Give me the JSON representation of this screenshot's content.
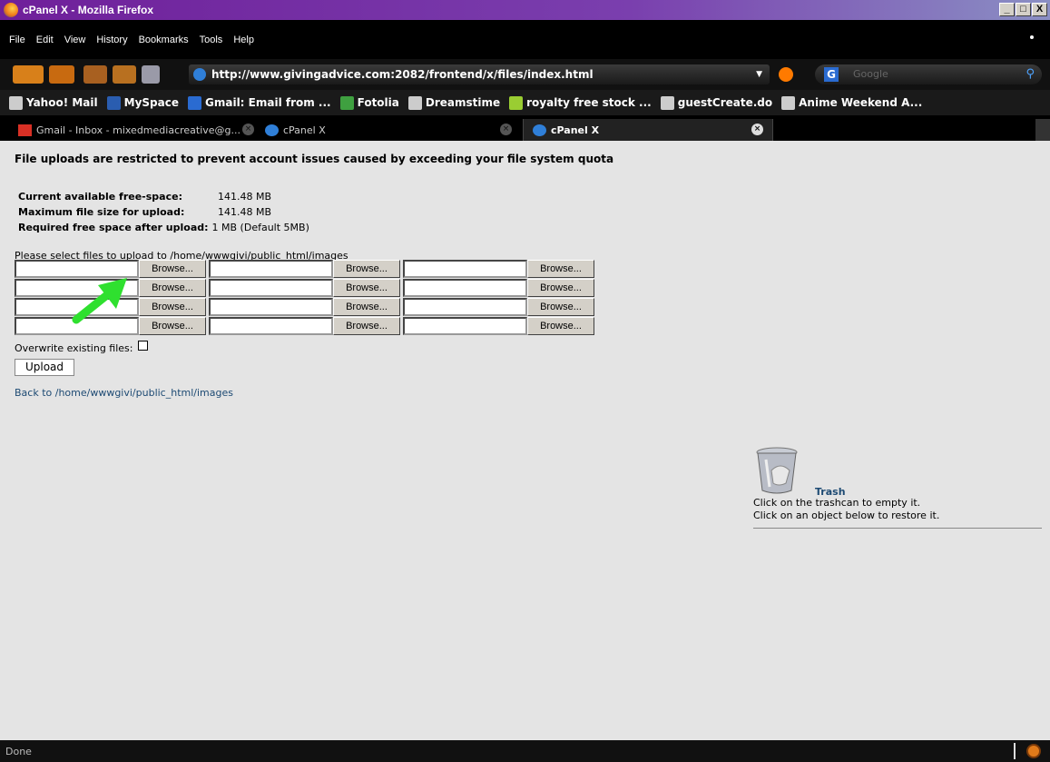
{
  "window": {
    "title": "cPanel X - Mozilla Firefox",
    "buttons": [
      "_",
      "□",
      "X"
    ]
  },
  "menu": [
    "File",
    "Edit",
    "View",
    "History",
    "Bookmarks",
    "Tools",
    "Help"
  ],
  "nav": {
    "url": "http://www.givingadvice.com:2082/frontend/x/files/index.html",
    "search_placeholder": "Google"
  },
  "bookmarks": [
    {
      "label": "Yahoo! Mail",
      "color": "#cccccc"
    },
    {
      "label": "MySpace",
      "color": "#2a5db0"
    },
    {
      "label": "Gmail: Email from ...",
      "color": "#2a6bd1"
    },
    {
      "label": "Fotolia",
      "color": "#3fa040"
    },
    {
      "label": "Dreamstime",
      "color": "#cccccc"
    },
    {
      "label": "royalty free stock ...",
      "color": "#9acd32"
    },
    {
      "label": "guestCreate.do",
      "color": "#cccccc"
    },
    {
      "label": "Anime Weekend A...",
      "color": "#cccccc"
    }
  ],
  "tabs": [
    {
      "label": "Gmail - Inbox - mixedmediacreative@g...",
      "active": false
    },
    {
      "label": "cPanel X",
      "active": false
    },
    {
      "label": "cPanel X",
      "active": true
    }
  ],
  "page": {
    "heading": "File uploads are restricted to prevent account issues caused by exceeding your file system quota",
    "free_space_label": "Current available free-space:",
    "free_space_value": "141.48 MB",
    "max_size_label": "Maximum file size for upload:",
    "max_size_value": "141.48 MB",
    "required_label": "Required free space after upload:",
    "required_value": "1 MB (Default 5MB)",
    "select_label": "Please select files to upload to /home/wwwgivi/public_html/images",
    "browse_label": "Browse...",
    "overwrite_label": "Overwrite existing files:",
    "upload_label": "Upload",
    "back_link": "Back to /home/wwwgivi/public_html/images"
  },
  "trash": {
    "title": "Trash",
    "line1": "Click on the trashcan to empty it.",
    "line2": "Click on an object below to restore it."
  },
  "status": {
    "text": "Done"
  }
}
